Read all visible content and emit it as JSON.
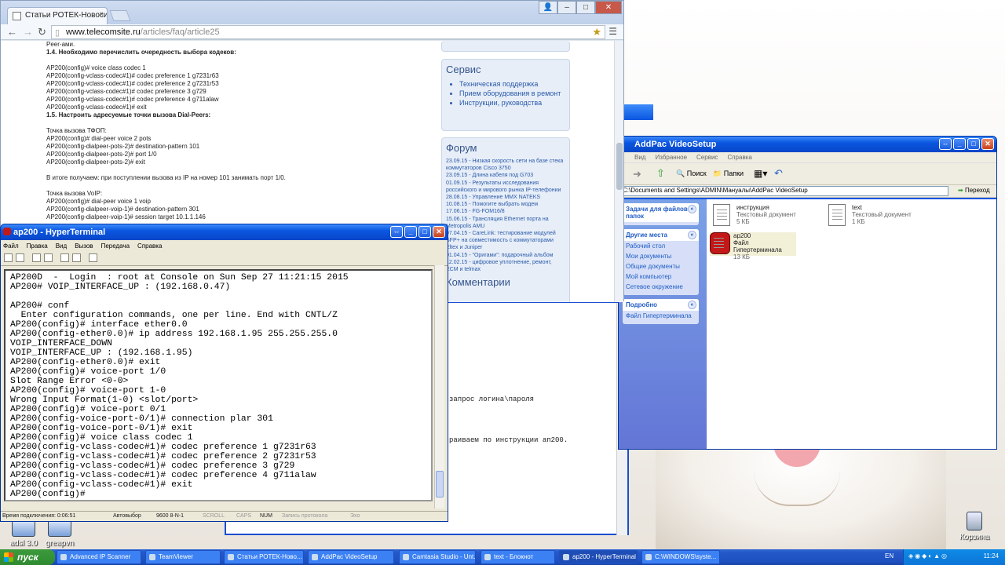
{
  "browser": {
    "tab_title": "Статьи РОТЕК-Новосибирск",
    "url_host": "www.telecomsite.ru",
    "url_path": "/articles/faq/article25",
    "article": [
      {
        "t": "Peer-ами.",
        "b": false
      },
      {
        "t": "1.4. Необходимо перечислить очередность выбора кодеков:",
        "b": true
      },
      {
        "t": "",
        "b": false
      },
      {
        "t": "AP200(config)# voice class codec 1",
        "b": false
      },
      {
        "t": "AP200(config-vclass-codec#1)# codec preference 1 g7231r63",
        "b": false
      },
      {
        "t": "AP200(config-vclass-codec#1)# codec preference 2 g7231r53",
        "b": false
      },
      {
        "t": "AP200(config-vclass-codec#1)# codec preference 3 g729",
        "b": false
      },
      {
        "t": "AP200(config-vclass-codec#1)# codec preference 4 g711alaw",
        "b": false
      },
      {
        "t": "AP200(config-vclass-codec#1)# exit",
        "b": false
      },
      {
        "t": "1.5. Настроить адресуемые точки вызова Dial-Peers:",
        "b": true
      },
      {
        "t": "",
        "b": false
      },
      {
        "t": "Точка вызова ТФОП:",
        "b": false
      },
      {
        "t": "AP200(config)# dial-peer voice 2 pots",
        "b": false
      },
      {
        "t": "AP200(config-dialpeer-pots-2)# destination-pattern 101",
        "b": false
      },
      {
        "t": "AP200(config-dialpeer-pots-2)# port 1/0",
        "b": false
      },
      {
        "t": "AP200(config-dialpeer-pots-2)# exit",
        "b": false
      },
      {
        "t": "",
        "b": false
      },
      {
        "t": "В итоге получаем: при поступлении вызова из IP на номер 101 занимать порт 1/0.",
        "b": false
      },
      {
        "t": "",
        "b": false
      },
      {
        "t": "Точка вызова VoIP:",
        "b": false
      },
      {
        "t": "AP200(config)# dial-peer voice 1 voip",
        "b": false
      },
      {
        "t": "AP200(config-dialpeer-voip-1)# destination-pattern 301",
        "b": false
      },
      {
        "t": "AP200(config-dialpeer-voip-1)# session target 10.1.1.146",
        "b": false
      }
    ],
    "service_title": "Сервис",
    "service_items": [
      "Техническая поддержка",
      "Прием оборудования в ремонт",
      "Инструкции, руководства"
    ],
    "forum_title": "Форум",
    "forum_items": [
      "23.09.15 - Низкая скорость сети на базе стека коммутаторов Cisco 3750",
      "23.09.15 - Длина кабеля под G703",
      "01.09.15 - Результаты исследования российского и мирового рынка IP-телефонии",
      "28.08.15 - Управление MMX NATEKS",
      "10.08.15 - Помогите выбрать модем",
      "17.06.15 - FG-FOM16/8",
      "15.06.15 - Трансляция Ethernet порта на Metropolis AMU",
      "07.04.15 - CareLink: тестирование модулей SFP+ на совместимость с коммутаторами Eltex и Juniper",
      "01.04.15 - \"Оригами\": подарочный альбом",
      "12.02.15 - цифровое уплотнение, ремонт, ECM и telmax"
    ],
    "comments_title": "Комментарии"
  },
  "explorer": {
    "title": "AddPac VideoSetup",
    "search_label": "Поиск",
    "folders_label": "Папки",
    "address": "C:\\Documents and Settings\\ADMIN\\Мануалы\\AddPac VideoSetup",
    "go_label": "Переход",
    "menu": [
      "Вид",
      "Избранное",
      "Сервис",
      "Справка"
    ],
    "tasks_title": "Задачи для файлов и папок",
    "places_title": "Другие места",
    "places": [
      "Рабочий стол",
      "Мои документы",
      "Общие документы",
      "Мой компьютер",
      "Сетевое окружение"
    ],
    "details_title": "Подробно",
    "details_text": "Файл Гипертерминала",
    "files": [
      {
        "name": "инструкция",
        "type": "Текстовый документ",
        "size": "5 КБ"
      },
      {
        "name": "text",
        "type": "Текстовый документ",
        "size": "1 КБ"
      },
      {
        "name": "ap200",
        "type": "Файл Гипертерминала",
        "size": "13 КБ"
      }
    ]
  },
  "notepad": {
    "lines": [
      "запрос логина\\пароля",
      "",
      "раиваем по инструкции ап200."
    ]
  },
  "terminal": {
    "title": "ap200 - HyperTerminal",
    "menu": [
      "Файл",
      "Правка",
      "Вид",
      "Вызов",
      "Передача",
      "Справка"
    ],
    "lines": [
      "AP200D  -  Login  : root at Console on Sun Sep 27 11:21:15 2015",
      "AP200# VOIP_INTERFACE_UP : (192.168.0.47)",
      "",
      "AP200# conf",
      "  Enter configuration commands, one per line. End with CNTL/Z",
      "AP200(config)# interface ether0.0",
      "AP200(config-ether0.0)# ip address 192.168.1.95 255.255.255.0",
      "VOIP_INTERFACE_DOWN",
      "VOIP_INTERFACE_UP : (192.168.1.95)",
      "AP200(config-ether0.0)# exit",
      "AP200(config)# voice-port 1/0",
      "Slot Range Error <0-0>",
      "AP200(config)# voice-port 1-0",
      "Wrong Input Format(1-0) <slot/port>",
      "AP200(config)# voice-port 0/1",
      "AP200(config-voice-port-0/1)# connection plar 301",
      "AP200(config-voice-port-0/1)# exit",
      "AP200(config)# voice class codec 1",
      "AP200(config-vclass-codec#1)# codec preference 1 g7231r63",
      "AP200(config-vclass-codec#1)# codec preference 2 g7231r53",
      "AP200(config-vclass-codec#1)# codec preference 3 g729",
      "AP200(config-vclass-codec#1)# codec preference 4 g711alaw",
      "AP200(config-vclass-codec#1)# exit",
      "AP200(config)#"
    ],
    "status": {
      "connected": "Время подключения: 0:06:51",
      "detect": "Автовыбор",
      "params": "9600 8-N-1",
      "scroll": "SCROLL",
      "caps": "CAPS",
      "num": "NUM",
      "capture": "Запись протокола",
      "echo": "Эхо"
    }
  },
  "desktop": {
    "icons": [
      "adsl 3.0",
      "greapvn",
      "Корзина"
    ]
  },
  "taskbar": {
    "start": "пуск",
    "items": [
      {
        "label": "Advanced IP Scanner",
        "active": false
      },
      {
        "label": "TeamViewer",
        "active": false
      },
      {
        "label": "Статьи РОТЕК-Ново...",
        "active": false
      },
      {
        "label": "AddPac VideoSetup",
        "active": false
      },
      {
        "label": "Camtasia Studio - Unt...",
        "active": false
      },
      {
        "label": "text - Блокнот",
        "active": false
      },
      {
        "label": "ap200 - HyperTerminal",
        "active": true
      },
      {
        "label": "C:\\WINDOWS\\syste...",
        "active": false
      }
    ],
    "lang": "EN",
    "clock": "11:24"
  }
}
